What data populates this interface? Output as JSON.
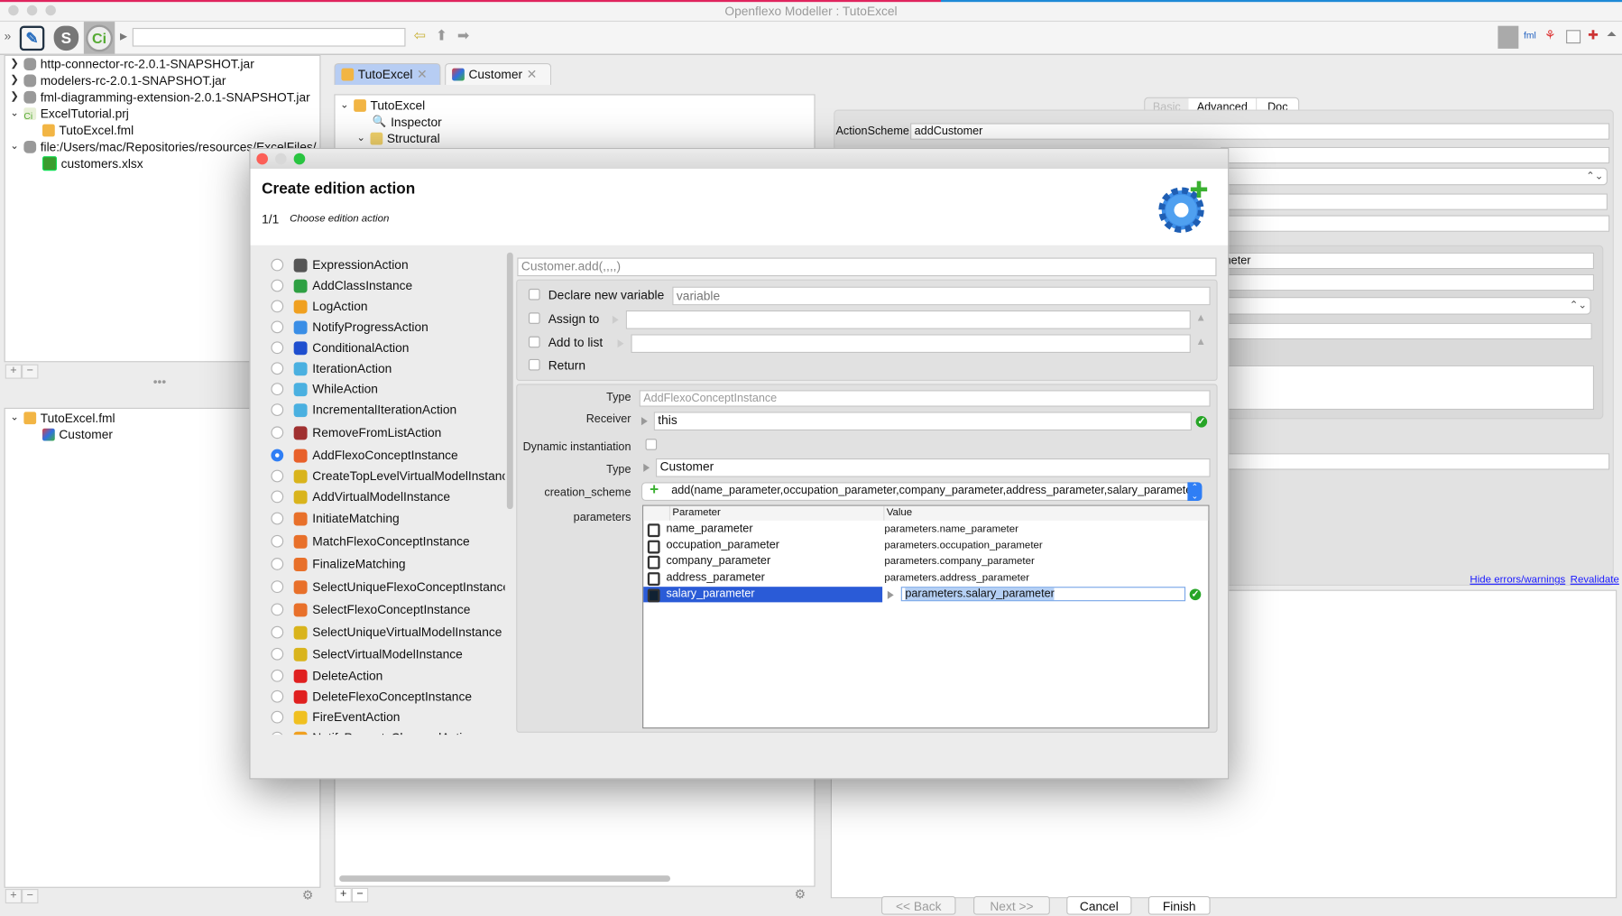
{
  "window": {
    "title": "Openflexo Modeller : TutoExcel"
  },
  "toolbar": {
    "address_value": "",
    "icons": [
      "collapse-icon",
      "diagram-editor-icon",
      "security-module-icon",
      "openflexo-icon",
      "back-arrow-icon",
      "up-arrow-icon",
      "forward-arrow-icon"
    ],
    "right_icons": [
      "openflexo-icon",
      "fml-file-icon",
      "hierarchy-icon",
      "window-icon",
      "puzzle-icon",
      "expand-icon"
    ]
  },
  "left_tree": {
    "items": [
      {
        "label": "http-connector-rc-2.0.1-SNAPSHOT.jar",
        "expanded": false
      },
      {
        "label": "modelers-rc-2.0.1-SNAPSHOT.jar",
        "expanded": false
      },
      {
        "label": "fml-diagramming-extension-2.0.1-SNAPSHOT.jar",
        "expanded": false
      },
      {
        "label": "ExcelTutorial.prj",
        "expanded": true
      },
      {
        "label": "TutoExcel.fml"
      },
      {
        "label": "file:/Users/mac/Repositories/resources/ExcelFiles/",
        "expanded": true
      },
      {
        "label": "customers.xlsx"
      }
    ]
  },
  "left_tree2": {
    "items": [
      {
        "label": "TutoExcel.fml"
      },
      {
        "label": "Customer"
      }
    ]
  },
  "editor_tabs": [
    {
      "label": "TutoExcel",
      "active": true
    },
    {
      "label": "Customer",
      "active": false
    }
  ],
  "editor_tree": {
    "items": [
      {
        "label": "TutoExcel"
      },
      {
        "label": "Inspector"
      },
      {
        "label": "Structural"
      }
    ]
  },
  "inspector": {
    "tabs": [
      {
        "label": "Basic"
      },
      {
        "label": "Advanced"
      },
      {
        "label": "Doc"
      }
    ],
    "action_scheme_label": "ActionScheme",
    "action_scheme_value": "addCustomer",
    "partial_value": "neter",
    "hide_errors_link": "Hide errors/warnings",
    "revalidate_link": "Revalidate"
  },
  "dialog": {
    "title": "Create edition action",
    "step": "1/1",
    "step_label": "Choose edition action",
    "actions": [
      {
        "label": "ExpressionAction",
        "icon": "expression-icon",
        "color": "#555555"
      },
      {
        "label": "AddClassInstance",
        "icon": "add-class-icon",
        "color": "#2ea043"
      },
      {
        "label": "LogAction",
        "icon": "pencil-icon",
        "color": "#f0a020"
      },
      {
        "label": "NotifyProgressAction",
        "icon": "play-icon",
        "color": "#3a8ee6"
      },
      {
        "label": "ConditionalAction",
        "icon": "question-icon",
        "color": "#1f4fcf"
      },
      {
        "label": "IterationAction",
        "icon": "loop-icon",
        "color": "#4ab0e0"
      },
      {
        "label": "WhileAction",
        "icon": "loop-icon",
        "color": "#4ab0e0"
      },
      {
        "label": "IncrementalIterationAction",
        "icon": "loop-icon",
        "color": "#4ab0e0"
      },
      {
        "label": "RemoveFromListAction",
        "icon": "remove-list-icon",
        "color": "#a03030"
      },
      {
        "label": "AddFlexoConceptInstance",
        "icon": "flexo-concept-add-icon",
        "color": "#e8602a",
        "selected": true
      },
      {
        "label": "CreateTopLevelVirtualModelInstance",
        "icon": "virtual-model-icon",
        "color": "#d9b41c"
      },
      {
        "label": "AddVirtualModelInstance",
        "icon": "virtual-model-icon",
        "color": "#d9b41c"
      },
      {
        "label": "InitiateMatching",
        "icon": "matching-icon",
        "color": "#e8702a"
      },
      {
        "label": "MatchFlexoConceptInstance",
        "icon": "matching-icon",
        "color": "#e8702a"
      },
      {
        "label": "FinalizeMatching",
        "icon": "matching-icon",
        "color": "#e8702a"
      },
      {
        "label": "SelectUniqueFlexoConceptInstance",
        "icon": "select-concept-icon",
        "color": "#e8702a"
      },
      {
        "label": "SelectFlexoConceptInstance",
        "icon": "select-concept-icon",
        "color": "#e8702a"
      },
      {
        "label": "SelectUniqueVirtualModelInstance",
        "icon": "select-vm-icon",
        "color": "#d9b41c"
      },
      {
        "label": "SelectVirtualModelInstance",
        "icon": "select-vm-icon",
        "color": "#d9b41c"
      },
      {
        "label": "DeleteAction",
        "icon": "delete-icon",
        "color": "#e02020"
      },
      {
        "label": "DeleteFlexoConceptInstance",
        "icon": "delete-icon",
        "color": "#e02020"
      },
      {
        "label": "FireEventAction",
        "icon": "event-icon",
        "color": "#f0c020"
      },
      {
        "label": "NotifyPropertyChangedAction",
        "icon": "notify-icon",
        "color": "#f0a020"
      }
    ],
    "expression_value": "Customer.add(,,,,)",
    "declare_variable_label": "Declare new variable",
    "declare_variable_placeholder": "variable",
    "assign_to_label": "Assign to",
    "add_to_list_label": "Add to list",
    "return_label": "Return",
    "type_label": "Type",
    "type_value": "AddFlexoConceptInstance",
    "receiver_label": "Receiver",
    "receiver_value": "this",
    "dynamic_label": "Dynamic instantiation",
    "type2_label": "Type",
    "type2_value": "Customer",
    "creation_scheme_label": "creation_scheme",
    "creation_scheme_value": "add(name_parameter,occupation_parameter,company_parameter,address_parameter,salary_parameter)",
    "parameters_label": "parameters",
    "param_headers": {
      "parameter": "Parameter",
      "value": "Value"
    },
    "params": [
      {
        "name": "name_parameter",
        "value": "parameters.name_parameter"
      },
      {
        "name": "occupation_parameter",
        "value": "parameters.occupation_parameter"
      },
      {
        "name": "company_parameter",
        "value": "parameters.company_parameter"
      },
      {
        "name": "address_parameter",
        "value": "parameters.address_parameter"
      },
      {
        "name": "salary_parameter",
        "value": "parameters.salary_parameter",
        "selected": true
      }
    ],
    "buttons": {
      "back": "<< Back",
      "next": "Next >>",
      "cancel": "Cancel",
      "finish": "Finish"
    }
  },
  "colors": {
    "selection": "#2a5bd7",
    "accent": "#2f7ef5",
    "valid": "#27a527",
    "link": "#1a1aff"
  }
}
